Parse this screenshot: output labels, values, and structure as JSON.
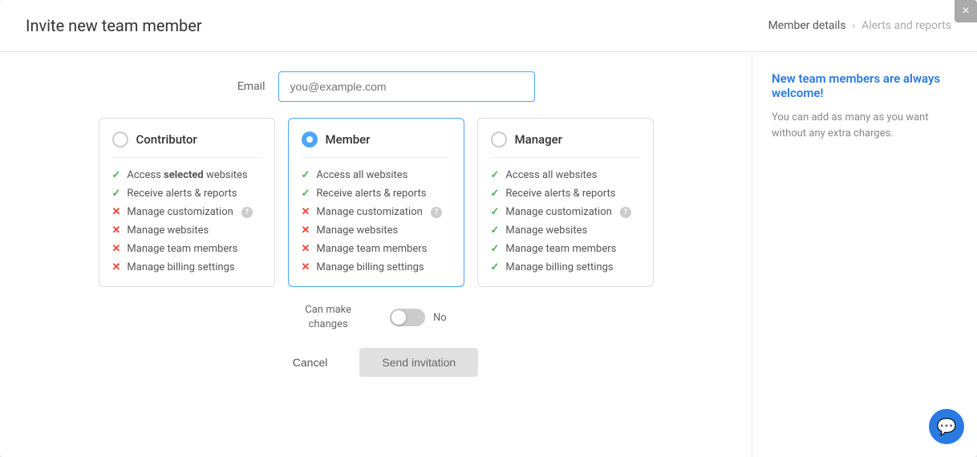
{
  "modal": {
    "title": "Invite new team member",
    "close_label": "×",
    "breadcrumb": {
      "step1": "Member details",
      "chevron": "›",
      "step2": "Alerts and reports"
    }
  },
  "email": {
    "label": "Email",
    "placeholder": "you@example.com"
  },
  "roles": [
    {
      "id": "contributor",
      "name": "Contributor",
      "selected": false,
      "features": [
        {
          "enabled": true,
          "text": "Access ",
          "bold": "selected",
          "text2": " websites",
          "info": false
        },
        {
          "enabled": true,
          "text": "Receive alerts & reports",
          "info": false
        },
        {
          "enabled": false,
          "text": "Manage customization",
          "info": true
        },
        {
          "enabled": false,
          "text": "Manage websites",
          "info": false
        },
        {
          "enabled": false,
          "text": "Manage team members",
          "info": false
        },
        {
          "enabled": false,
          "text": "Manage billing settings",
          "info": false
        }
      ]
    },
    {
      "id": "member",
      "name": "Member",
      "selected": true,
      "features": [
        {
          "enabled": true,
          "text": "Access all websites",
          "info": false
        },
        {
          "enabled": true,
          "text": "Receive alerts & reports",
          "info": false
        },
        {
          "enabled": false,
          "text": "Manage customization",
          "info": true
        },
        {
          "enabled": false,
          "text": "Manage websites",
          "info": false
        },
        {
          "enabled": false,
          "text": "Manage team members",
          "info": false
        },
        {
          "enabled": false,
          "text": "Manage billing settings",
          "info": false
        }
      ]
    },
    {
      "id": "manager",
      "name": "Manager",
      "selected": false,
      "features": [
        {
          "enabled": true,
          "text": "Access all websites",
          "info": false
        },
        {
          "enabled": true,
          "text": "Receive alerts & reports",
          "info": false
        },
        {
          "enabled": true,
          "text": "Manage customization",
          "info": true
        },
        {
          "enabled": true,
          "text": "Manage websites",
          "info": false
        },
        {
          "enabled": true,
          "text": "Manage team members",
          "info": false
        },
        {
          "enabled": true,
          "text": "Manage billing settings",
          "info": false
        }
      ]
    }
  ],
  "can_make_changes": {
    "label": "Can make\nchanges",
    "toggle_state": "off",
    "toggle_label": "No"
  },
  "actions": {
    "cancel_label": "Cancel",
    "send_label": "Send invitation"
  },
  "sidebar": {
    "title": "New team members are always welcome!",
    "description": "You can add as many as you want without any extra charges."
  }
}
